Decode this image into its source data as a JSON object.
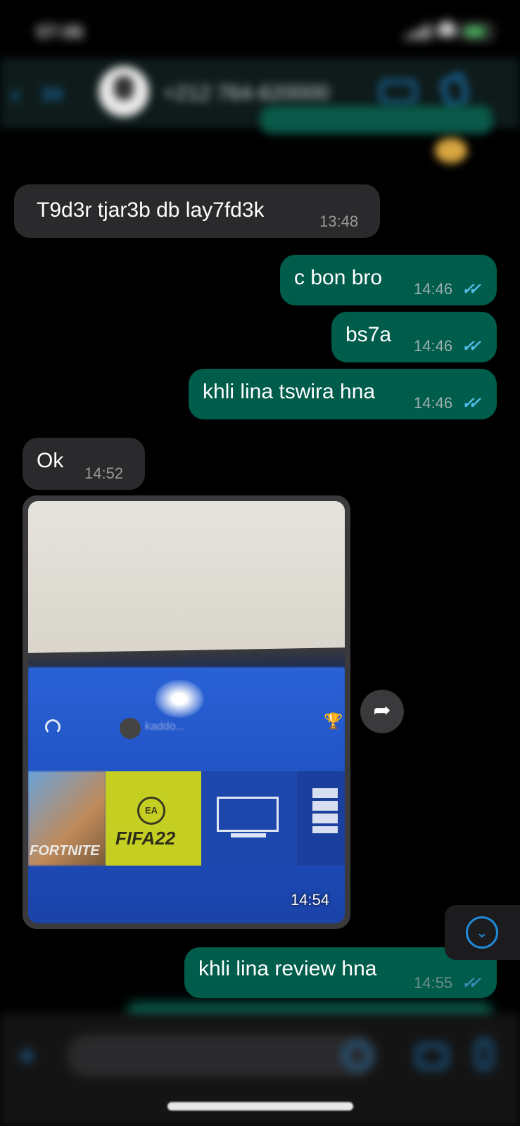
{
  "status_bar": {
    "time": "07:06"
  },
  "header": {
    "back_label": "‹",
    "back_count": "34",
    "contact_name": "+212 764-620000"
  },
  "messages": [
    {
      "direction": "in",
      "text": "T9d3r tjar3b db lay7fd3k",
      "time": "13:48"
    },
    {
      "direction": "out",
      "text": "c bon bro",
      "time": "14:46",
      "ticks": "✓✓"
    },
    {
      "direction": "out",
      "text": "bs7a",
      "time": "14:46",
      "ticks": "✓✓"
    },
    {
      "direction": "out",
      "text": "khli lina tswira hna",
      "time": "14:46",
      "ticks": "✓✓"
    },
    {
      "direction": "in",
      "text": "Ok",
      "time": "14:52"
    },
    {
      "direction": "out",
      "text": "khli lina review hna",
      "time": "14:55",
      "ticks": "✓✓"
    }
  ],
  "image_message": {
    "time": "14:54",
    "photo_texts": {
      "profile_name": "kaddo...",
      "fortnite_label": "FORTNITE",
      "ea_label": "EA",
      "fifa_label": "FIFA22"
    }
  },
  "icons": {
    "forward": "➦",
    "scroll_down": "⌄",
    "plus": "+",
    "trophy": "🏆"
  },
  "colors": {
    "outgoing_bubble": "#005c4b",
    "incoming_bubble": "#2a2a2c",
    "read_ticks": "#53bdeb",
    "accent": "#1f8ad8"
  }
}
